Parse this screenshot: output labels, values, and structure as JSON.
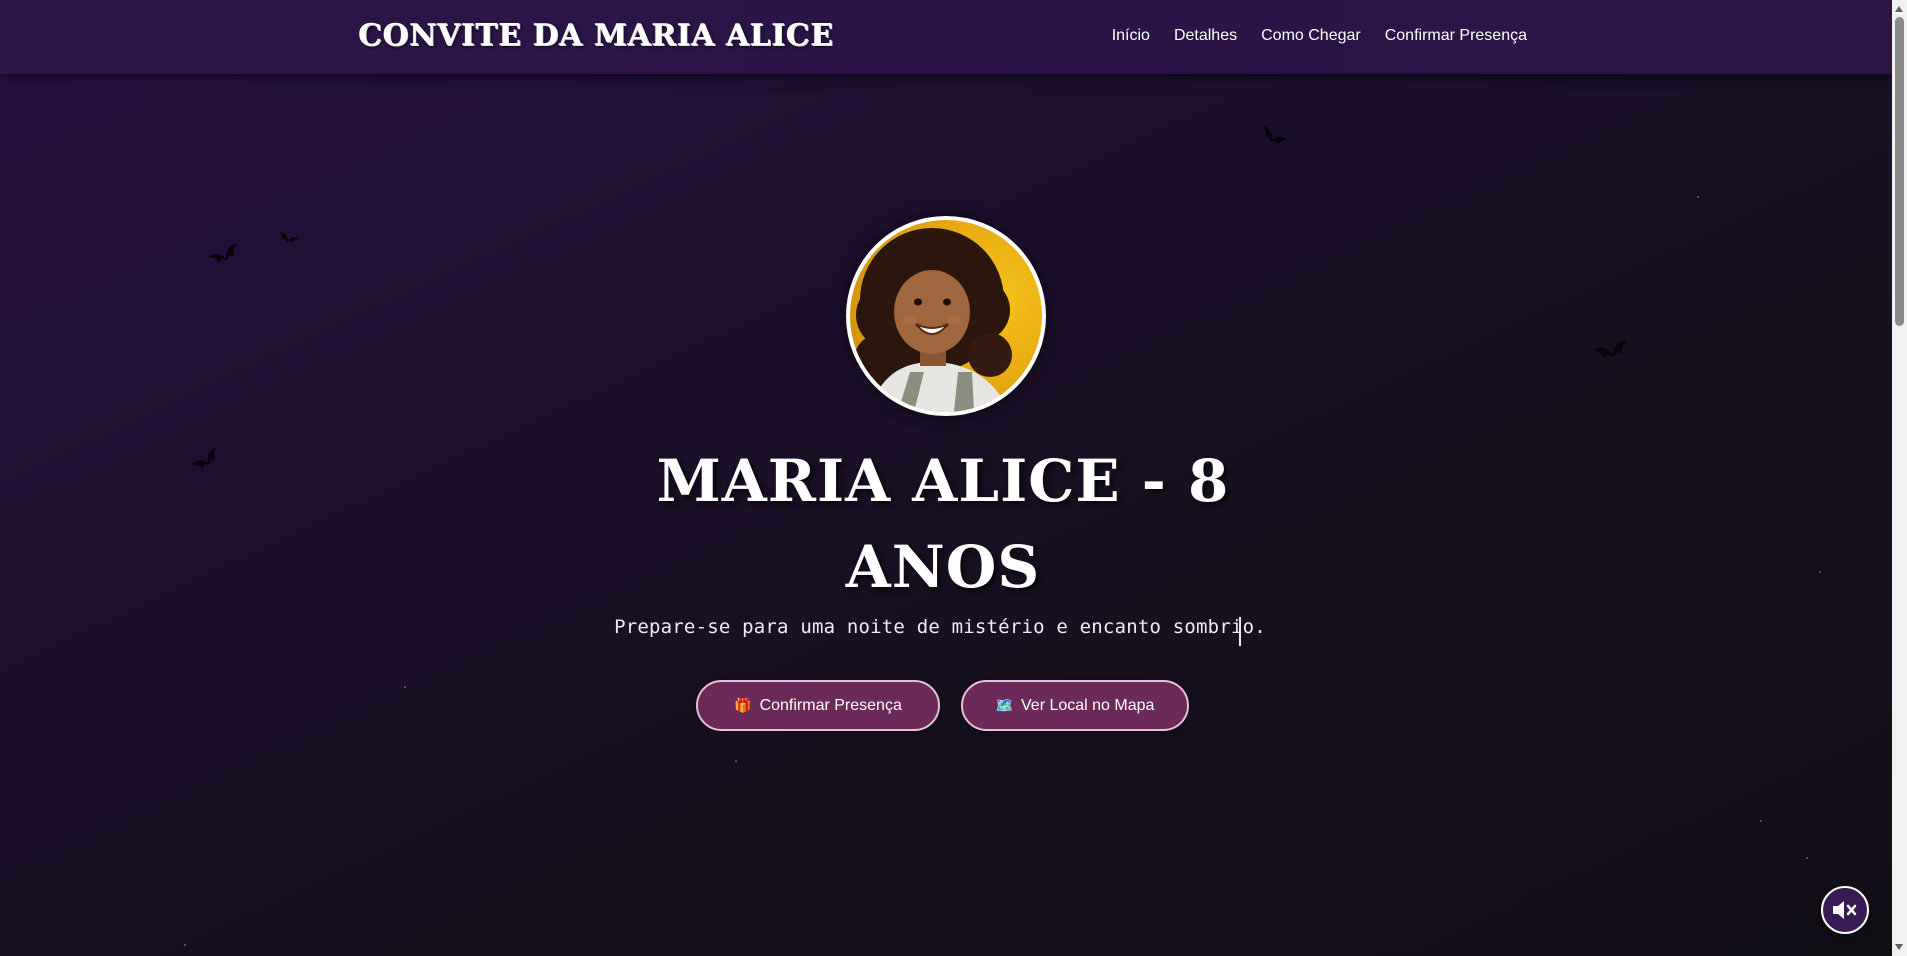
{
  "nav": {
    "brand": "CONVITE DA MARIA ALICE",
    "links": [
      "Início",
      "Detalhes",
      "Como Chegar",
      "Confirmar Presença"
    ]
  },
  "hero": {
    "title_line1": "MARIA ALICE - 8",
    "title_line2": "ANOS",
    "subtitle": "Prepare-se para uma noite de mistério e encanto sombrio.",
    "buttons": {
      "rsvp_icon": "🎁",
      "rsvp_label": "Confirmar Presença",
      "map_icon": "🗺️",
      "map_label": "Ver Local no Mapa"
    }
  },
  "colors": {
    "navbar": "#2c1446",
    "button_bg": "#6c2a58",
    "button_border": "#e3c1dd"
  },
  "icons": {
    "bats": "bat-icon",
    "mute": "speaker-muted-icon"
  }
}
